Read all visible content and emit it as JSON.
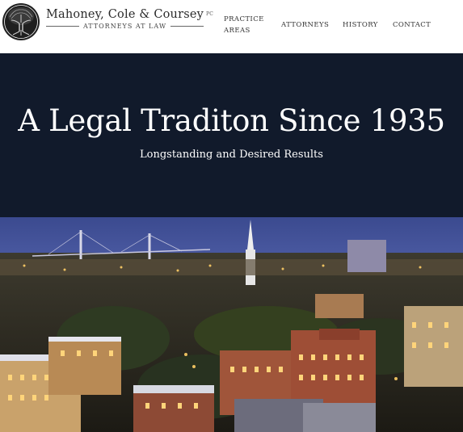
{
  "header": {
    "logo": {
      "icon": "tree-icon"
    },
    "brand": {
      "name": "Mahoney, Cole & Coursey",
      "suffix": "PC",
      "subtitle": "ATTORNEYS AT LAW"
    },
    "nav": {
      "practice_areas_line1": "PRACTICE",
      "practice_areas_line2": "AREAS",
      "attorneys": "ATTORNEYS",
      "history": "HISTORY",
      "contact": "CONTACT"
    }
  },
  "hero": {
    "title": "A Legal Traditon Since 1935",
    "subtitle": "Longstanding and Desired Results",
    "background": "#111a2b"
  },
  "photo": {
    "subject": "city skyline at dusk"
  }
}
